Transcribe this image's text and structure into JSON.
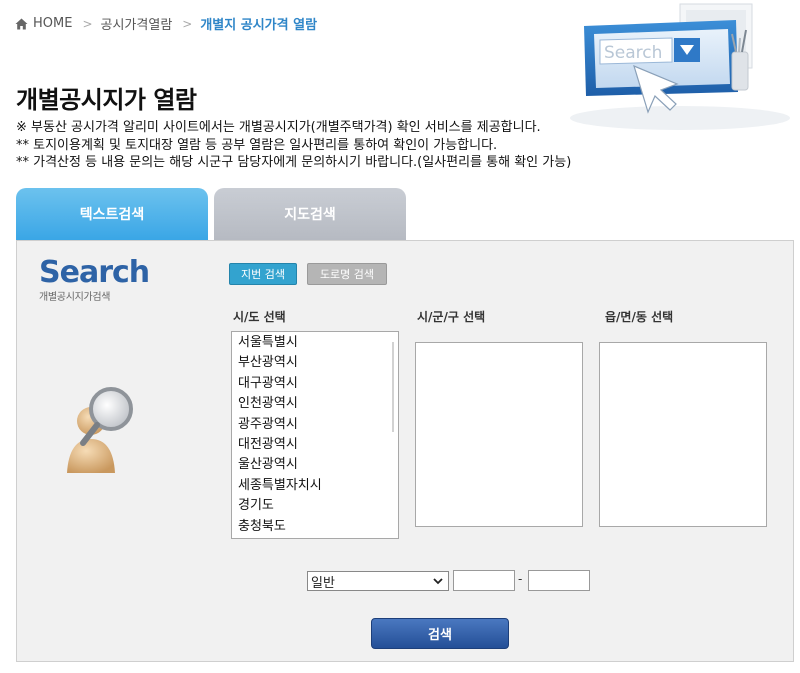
{
  "breadcrumb": {
    "home": "HOME",
    "level1": "공시가격열람",
    "current": "개별지 공시가격 열람"
  },
  "hero": {
    "search_text": "Search"
  },
  "page": {
    "title": "개별공시지가 열람",
    "notes": [
      "※ 부동산 공시가격 알리미 사이트에서는 개별공시지가(개별주택가격) 확인 서비스를 제공합니다.",
      "** 토지이용계획 및 토지대장 열람 등 공부 열람은 일사편리를 통하여 확인이 가능합니다.",
      "** 가격산정 등 내용 문의는 해당 시군구 담당자에게 문의하시기 바랍니다.(일사편리를 통해 확인 가능)"
    ]
  },
  "tabs": {
    "text_search": "텍스트검색",
    "map_search": "지도검색"
  },
  "panel": {
    "logo_word": "Search",
    "logo_sub": "개별공시지가검색",
    "subtabs": {
      "jibun": "지번 검색",
      "road": "도로명 검색"
    },
    "labels": {
      "sido": "시/도 선택",
      "sigungu": "시/군/구 선택",
      "dong": "읍/면/동 선택"
    },
    "sido_options": [
      "서울특별시",
      "부산광역시",
      "대구광역시",
      "인천광역시",
      "광주광역시",
      "대전광역시",
      "울산광역시",
      "세종특별자치시",
      "경기도",
      "충청북도"
    ],
    "type_select": {
      "value": "일반"
    },
    "lot_main": "",
    "lot_sub": "",
    "dash": "-",
    "search_button": "검색"
  },
  "colors": {
    "accent": "#2f86c8",
    "tab_active": "#3aa6e6",
    "button": "#2a5aa5"
  }
}
